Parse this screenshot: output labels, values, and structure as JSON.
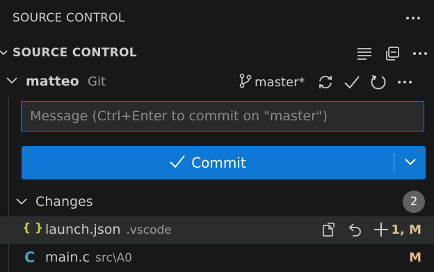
{
  "pane": {
    "title": "SOURCE CONTROL"
  },
  "section": {
    "title": "SOURCE CONTROL"
  },
  "repo": {
    "name": "matteo",
    "provider": "Git",
    "branch": "master*"
  },
  "commit": {
    "placeholder": "Message (Ctrl+Enter to commit on \"master\")",
    "button_label": "Commit",
    "accent": "#0e78d4"
  },
  "changes": {
    "label": "Changes",
    "count": "2",
    "files": [
      {
        "icon": "json-braces-icon",
        "glyph": "{ }",
        "name": "launch.json",
        "dir": ".vscode",
        "status": "1, M",
        "icon_color": "#cbcb41"
      },
      {
        "icon": "c-file-icon",
        "glyph": "C",
        "name": "main.c",
        "dir": "src\\A0",
        "status": "M",
        "icon_color": "#519aba"
      }
    ]
  },
  "colors": {
    "background": "#181818",
    "modified": "#e2c08d",
    "focus_border": "#2b79d0"
  }
}
